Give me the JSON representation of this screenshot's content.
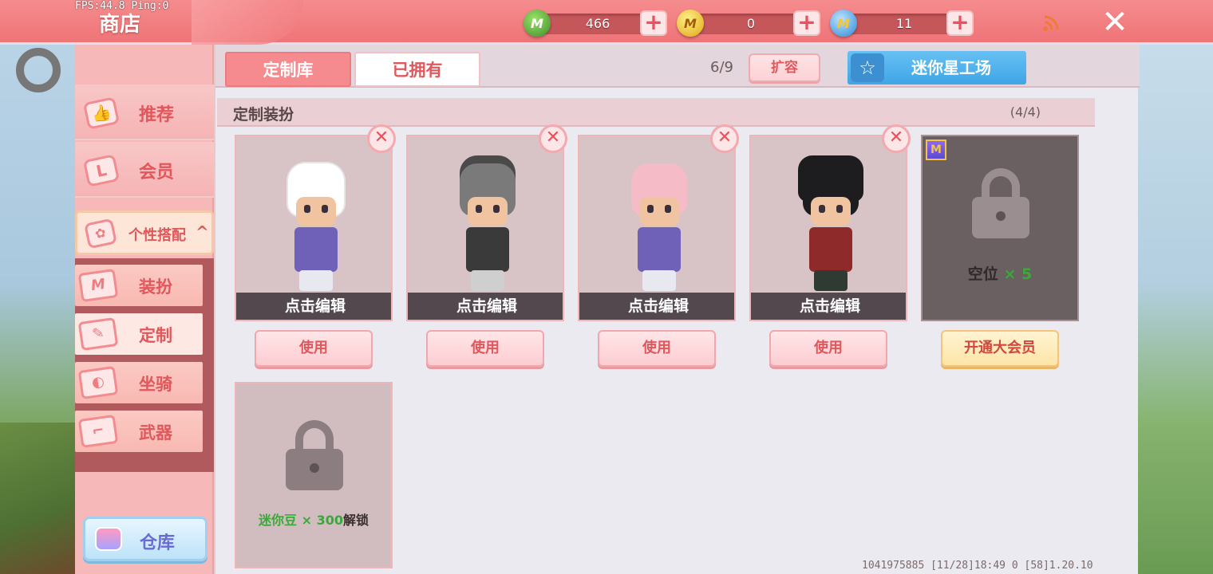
{
  "overlay": {
    "fps": "FPS:44.8  Ping:0"
  },
  "topbar": {
    "title": "商店",
    "currencies": [
      {
        "icon": "green-gem-coin-icon",
        "symbol": "M",
        "value": "466"
      },
      {
        "icon": "gold-coin-icon",
        "symbol": "M",
        "value": "0"
      },
      {
        "icon": "blue-coin-icon",
        "symbol": "M",
        "value": "11"
      }
    ],
    "plus": "+",
    "close": "✕"
  },
  "sidebar": {
    "items": [
      {
        "label": "推荐",
        "icon": "thumbs-up-icon",
        "glyph": "👍"
      },
      {
        "label": "会员",
        "icon": "member-card-icon",
        "glyph": "L"
      }
    ],
    "expanded": {
      "label": "个性搭配",
      "caret": "^"
    },
    "sub_items": [
      {
        "label": "装扮",
        "icon": "outfit-icon",
        "glyph": "M",
        "active": false
      },
      {
        "label": "定制",
        "icon": "custom-pencil-icon",
        "glyph": "✎",
        "active": true
      },
      {
        "label": "坐骑",
        "icon": "mount-icon",
        "glyph": "◐",
        "active": false
      },
      {
        "label": "武器",
        "icon": "weapon-gun-icon",
        "glyph": "⌐",
        "active": false
      }
    ],
    "warehouse": "仓库"
  },
  "main": {
    "tabs": [
      "定制库",
      "已拥有"
    ],
    "capacity": "6/9",
    "expand_label": "扩容",
    "star_workshop": "迷你星工场",
    "section_title": "定制装扮",
    "section_count": "(4/4)",
    "cards": [
      {
        "edit": "点击编辑",
        "use": "使用",
        "hair": "#ffffff",
        "top": "#6f60b8",
        "legs": "#e8e8f0"
      },
      {
        "edit": "点击编辑",
        "use": "使用",
        "hair": "#7a7a7a",
        "top": "#3a3a3a",
        "legs": "#cfcfcf"
      },
      {
        "edit": "点击编辑",
        "use": "使用",
        "hair": "#f5bcc8",
        "top": "#6f60b8",
        "legs": "#e8e8f0"
      },
      {
        "edit": "点击编辑",
        "use": "使用",
        "hair": "#1d1d1f",
        "top": "#8e2a2a",
        "legs": "#2e3a32"
      }
    ],
    "vip_slot": {
      "text_prefix": "空位",
      "text_count": "× 5",
      "button": "开通大会员",
      "badge": "M"
    },
    "locked_slot": {
      "text_prefix": "迷你豆",
      "text_count": "× 300",
      "text_suffix": "解锁"
    },
    "footer": "1041975885   [11/28]18:49 0   [58]1.20.10"
  },
  "colors": {
    "topbar": "#ef7477",
    "accent": "#e0575c",
    "tab_active": "#f58b8f",
    "workshop": "#3fa5e6",
    "green_text": "#3aa93a"
  }
}
